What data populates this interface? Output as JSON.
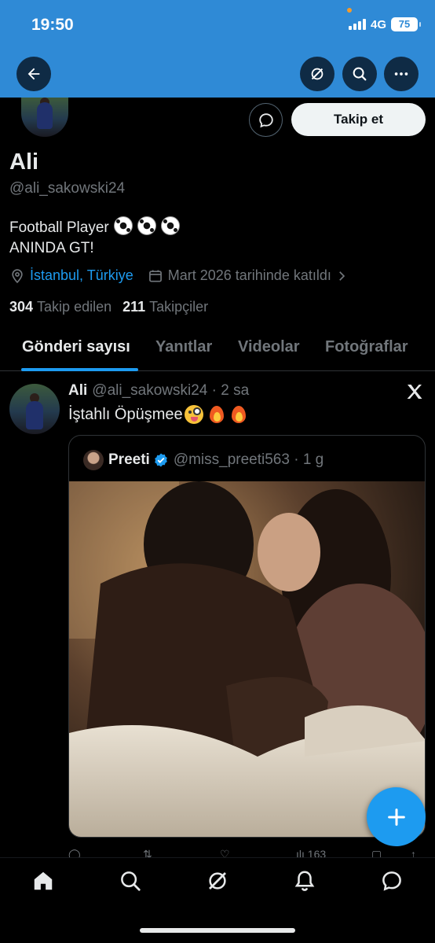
{
  "status_bar": {
    "time": "19:50",
    "network": "4G",
    "battery": "75"
  },
  "header": {
    "back_icon": "arrow-left-icon",
    "grok_icon": "grok-icon",
    "search_icon": "search-icon",
    "more_icon": "more-horizontal-icon"
  },
  "profile": {
    "name": "Ali",
    "handle": "@ali_sakowski24",
    "follow_label": "Takip et",
    "bio_line1": "Football Player",
    "bio_line2": "ANINDA GT!",
    "location": "İstanbul, Türkiye",
    "joined": "Mart 2026 tarihinde katıldı",
    "following_count": "304",
    "following_label": "Takip edilen",
    "followers_count": "211",
    "followers_label": "Takipçiler"
  },
  "tabs": [
    {
      "label": "Gönderi sayısı",
      "active": true
    },
    {
      "label": "Yanıtlar"
    },
    {
      "label": "Videolar"
    },
    {
      "label": "Fotoğraflar"
    }
  ],
  "tweet": {
    "author": "Ali",
    "handle": "@ali_sakowski24",
    "time": "· 2 sa",
    "text": "İştahlı Öpüşmee",
    "quote": {
      "author": "Preeti",
      "handle": "@miss_preeti563",
      "time": "· 1 g"
    },
    "views": "163"
  },
  "colors": {
    "accent": "#1d9bf0",
    "banner": "#2f8ad6",
    "background": "#000000"
  },
  "bottom_nav": [
    "home-icon",
    "search-icon",
    "grok-icon",
    "notifications-icon",
    "messages-icon"
  ]
}
